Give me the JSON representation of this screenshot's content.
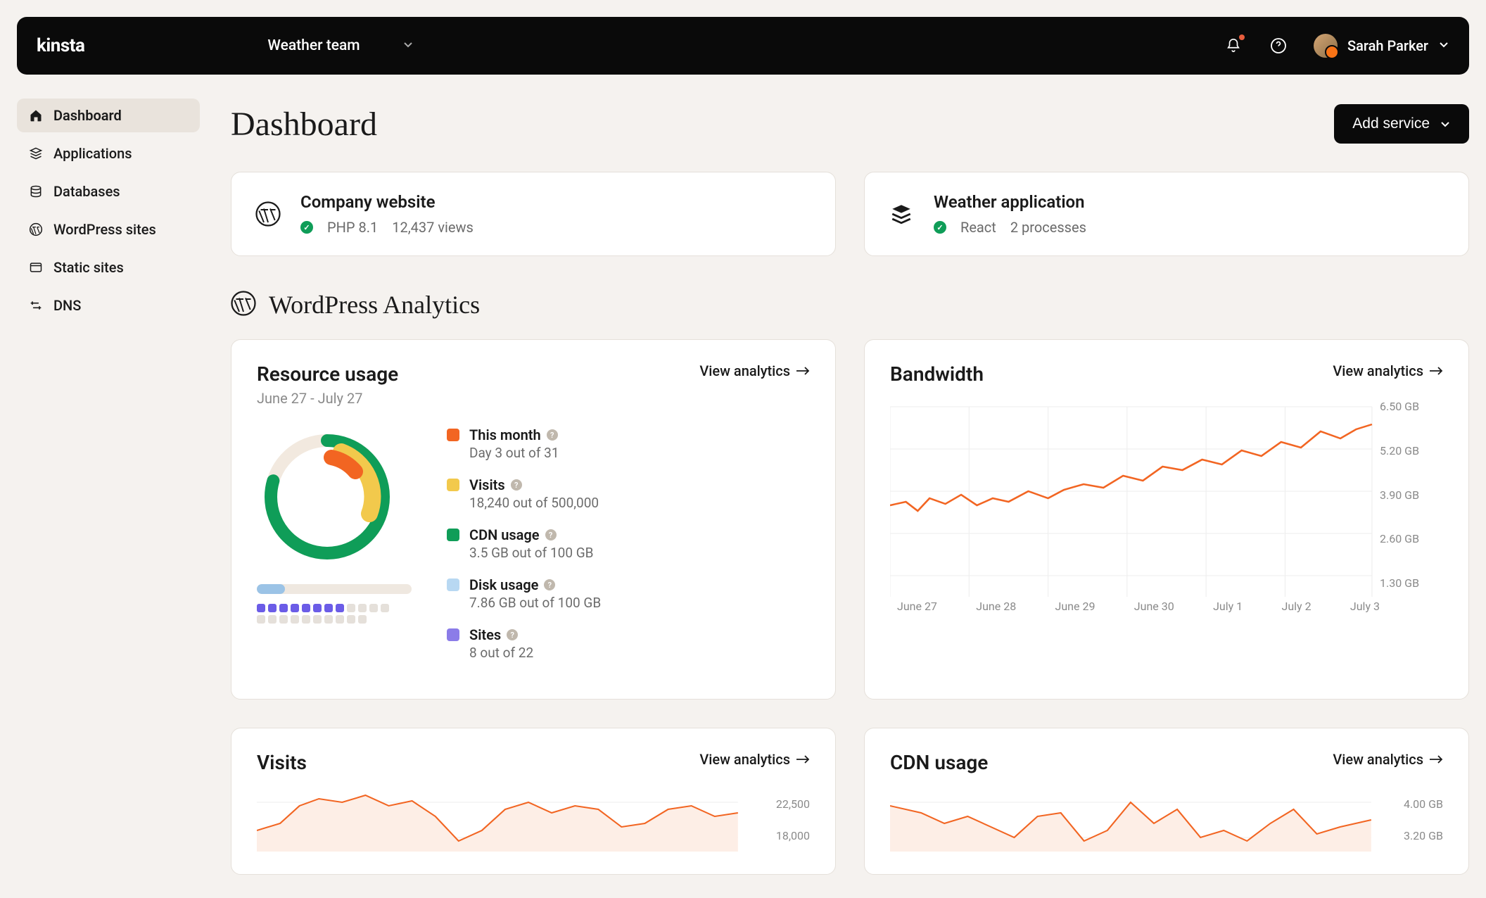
{
  "header": {
    "logo": "kinsta",
    "team": "Weather team",
    "user": "Sarah Parker"
  },
  "sidebar": {
    "items": [
      {
        "label": "Dashboard",
        "active": true
      },
      {
        "label": "Applications",
        "active": false
      },
      {
        "label": "Databases",
        "active": false
      },
      {
        "label": "WordPress sites",
        "active": false
      },
      {
        "label": "Static sites",
        "active": false
      },
      {
        "label": "DNS",
        "active": false
      }
    ]
  },
  "page": {
    "title": "Dashboard",
    "add_service": "Add service"
  },
  "cards": [
    {
      "title": "Company website",
      "tech": "PHP 8.1",
      "metric": "12,437 views"
    },
    {
      "title": "Weather application",
      "tech": "React",
      "metric": "2 processes"
    }
  ],
  "wp_section": "WordPress Analytics",
  "view_analytics": "View analytics",
  "resource": {
    "title": "Resource usage",
    "range": "June 27 - July 27",
    "legend": [
      {
        "color": "#f26522",
        "label": "This month",
        "sub": "Day 3 out of 31"
      },
      {
        "color": "#f2c94c",
        "label": "Visits",
        "sub": "18,240 out of 500,000"
      },
      {
        "color": "#0f9d58",
        "label": "CDN usage",
        "sub": "3.5 GB out of 100 GB"
      },
      {
        "color": "#b8d8f2",
        "label": "Disk usage",
        "sub": "7.86 GB out of 100 GB"
      },
      {
        "color": "#8b7ce8",
        "label": "Sites",
        "sub": "8 out of 22"
      }
    ]
  },
  "bandwidth": {
    "title": "Bandwidth",
    "y": [
      "6.50 GB",
      "5.20 GB",
      "3.90 GB",
      "2.60 GB",
      "1.30 GB"
    ],
    "x": [
      "June 27",
      "June 28",
      "June 29",
      "June 30",
      "July 1",
      "July 2",
      "July 3"
    ]
  },
  "visits": {
    "title": "Visits",
    "y": [
      "22,500",
      "18,000"
    ]
  },
  "cdn": {
    "title": "CDN usage",
    "y": [
      "4.00 GB",
      "3.20 GB"
    ]
  },
  "chart_data": [
    {
      "type": "pie",
      "title": "Resource usage",
      "series": [
        {
          "name": "This month",
          "value": 3,
          "total": 31
        },
        {
          "name": "Visits",
          "value": 18240,
          "total": 500000
        },
        {
          "name": "CDN usage",
          "value": 3.5,
          "total": 100,
          "unit": "GB"
        },
        {
          "name": "Disk usage",
          "value": 7.86,
          "total": 100,
          "unit": "GB"
        },
        {
          "name": "Sites",
          "value": 8,
          "total": 22
        }
      ]
    },
    {
      "type": "line",
      "title": "Bandwidth",
      "xlabel": "",
      "ylabel": "GB",
      "ylim": [
        1.3,
        6.5
      ],
      "x": [
        "June 27",
        "June 28",
        "June 29",
        "June 30",
        "July 1",
        "July 2",
        "July 3"
      ],
      "series": [
        {
          "name": "Bandwidth",
          "values": [
            3.9,
            3.8,
            4.0,
            4.2,
            4.3,
            4.6,
            4.9,
            5.2,
            5.4,
            5.6,
            5.9,
            6.0,
            6.2,
            6.1
          ]
        }
      ]
    },
    {
      "type": "area",
      "title": "Visits",
      "ylim": [
        0,
        22500
      ],
      "series": [
        {
          "name": "Visits",
          "values": [
            14000,
            16000,
            20000,
            21000,
            18000,
            15000,
            17000,
            21000,
            19000,
            16000,
            17000
          ]
        }
      ]
    },
    {
      "type": "area",
      "title": "CDN usage",
      "ylim": [
        0,
        4.0
      ],
      "series": [
        {
          "name": "CDN usage",
          "values": [
            3.6,
            3.4,
            3.2,
            3.5,
            2.8,
            3.4,
            2.6,
            3.8,
            3.2,
            2.6,
            3.2
          ]
        }
      ]
    }
  ]
}
